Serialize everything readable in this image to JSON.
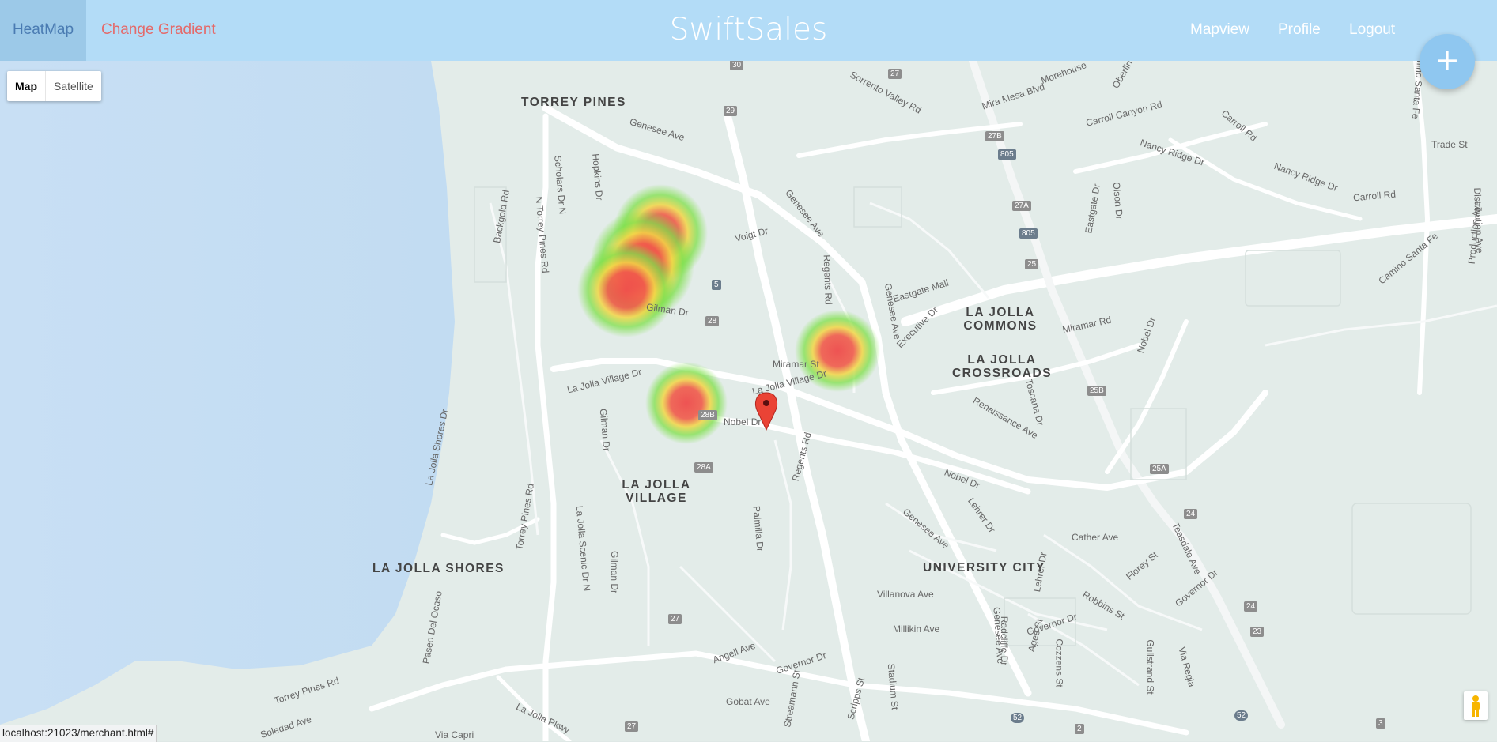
{
  "navbar": {
    "heatmap_tab": "HeatMap",
    "change_gradient": "Change Gradient",
    "brand": "SwiftSales",
    "mapview": "Mapview",
    "profile": "Profile",
    "logout": "Logout",
    "fab_label": "+"
  },
  "map": {
    "map_type_map": "Map",
    "map_type_satellite": "Satellite",
    "areas": {
      "torrey_pines": "TORREY PINES",
      "la_jolla_commons": "LA JOLLA\nCOMMONS",
      "la_jolla_crossroads": "LA JOLLA\nCROSSROADS",
      "la_jolla_village": "LA JOLLA\nVILLAGE",
      "la_jolla_shores": "LA JOLLA SHORES",
      "university_city": "UNIVERSITY CITY"
    },
    "streets": {
      "genesee_ave": "Genesee Ave",
      "voigt_dr": "Voigt Dr",
      "gilman_dr": "Gilman Dr",
      "la_jolla_village_dr": "La Jolla Village Dr",
      "la_jolla_village_dr_2": "La Jolla Village Dr",
      "nobel_dr": "Nobel Dr",
      "nobel_dr_2": "Nobel Dr",
      "nobel_dr_3": "Nobel Dr",
      "miramar_st": "Miramar St",
      "miramar_rd": "Miramar Rd",
      "eastgate_mall": "Eastgate Mall",
      "executive_dr": "Executive Dr",
      "regents_rd": "Regents Rd",
      "regents_rd_2": "Regents Rd",
      "mira_mesa_blvd": "Mira Mesa Blvd",
      "carroll_canyon_rd": "Carroll Canyon Rd",
      "carroll_rd": "Carroll Rd",
      "nancy_ridge_dr": "Nancy Ridge Dr",
      "trade_st": "Trade St",
      "sorrento_valley_rd": "Sorrento Valley Rd",
      "n_torrey_pines_rd": "N Torrey Pines Rd",
      "torrey_pines_rd": "Torrey Pines Rd",
      "torrey_pines_rd_2": "Torrey Pines Rd",
      "hopkins_dr": "Hopkins Dr",
      "scholars_dr": "Scholars Dr N",
      "la_jolla_shores_dr": "La Jolla Shores Dr",
      "la_jolla_scenic_dr": "La Jolla Scenic Dr N",
      "gilman_dr_2": "Gilman Dr",
      "gilman_dr_3": "Gilman Dr",
      "cather_ave": "Cather Ave",
      "villanova_ave": "Villanova Ave",
      "millikin_ave": "Millikin Ave",
      "governor_dr": "Governor Dr",
      "governor_dr_2": "Governor Dr",
      "governor_dr_3": "Governor Dr",
      "angell_ave": "Angell Ave",
      "gobat_ave": "Gobat Ave",
      "genesee_ave_2": "Genesee Ave",
      "genesee_ave_3": "Genesee Ave",
      "genesee_ave_4": "Genesee Ave",
      "genesee_ave_5": "Genesee Ave",
      "camino_santa_fe": "Camino Santa Fe",
      "camino_santa_fe_2": "Camino Santa Fe",
      "production_ave": "Production Ave",
      "distribution_ave": "Distribution Ave",
      "toscana_dr": "Toscana Dr",
      "renaissance_ave": "Renaissance Ave",
      "robbins_st": "Robbins St",
      "florey_st": "Florey St",
      "lehrer_dr": "Lehrer Dr",
      "teasdale_ave": "Teasdale Ave",
      "radcliffe_dr": "Radcliffe Dr",
      "agee_st": "Agee St",
      "cozzens_st": "Cozzens St",
      "gullstrand_st": "Gullstrand St",
      "via_regla": "Via Regla",
      "paseo_del_ocaso": "Paseo Del Ocaso",
      "la_jolla_pkwy": "La Jolla Pkwy",
      "via_capri": "Via Capri",
      "soledad_ave": "Soledad Ave",
      "stadium_st": "Stadium St",
      "scripps_st": "Scripps St",
      "eastgate_dr": "Eastgate Dr",
      "olson_dr": "Olson Dr",
      "backgold_rd": "Backgold Rd",
      "oberlin": "Oberlin",
      "morehouse": "Morehouse",
      "palmilla_dr": "Palmilla Dr",
      "streamview_dr": "Streamann St",
      "lehrer_dr_2": "Lehrer Dr"
    },
    "shields": [
      "30",
      "27",
      "29",
      "27B",
      "805",
      "27A",
      "805",
      "25",
      "5",
      "28",
      "28B",
      "28A",
      "25B",
      "25A",
      "24",
      "24",
      "23",
      "27",
      "27",
      "52",
      "52",
      "2",
      "3"
    ]
  },
  "status_url": "localhost:21023/merchant.html#",
  "colors": {
    "navbar_bg": "#b3dcf7",
    "heatmap_tab_bg": "#9cc9e8",
    "heatmap_text": "#4a7bb2",
    "gradient_text": "#e46a6a",
    "fab_bg": "#8fc7f0",
    "water": "#c6dff3",
    "land": "#e3ece9",
    "heat_hot": "#ef4b4b",
    "heat_mid": "#f2d645",
    "heat_cool": "#7ee04a",
    "marker": "#ea4335"
  }
}
